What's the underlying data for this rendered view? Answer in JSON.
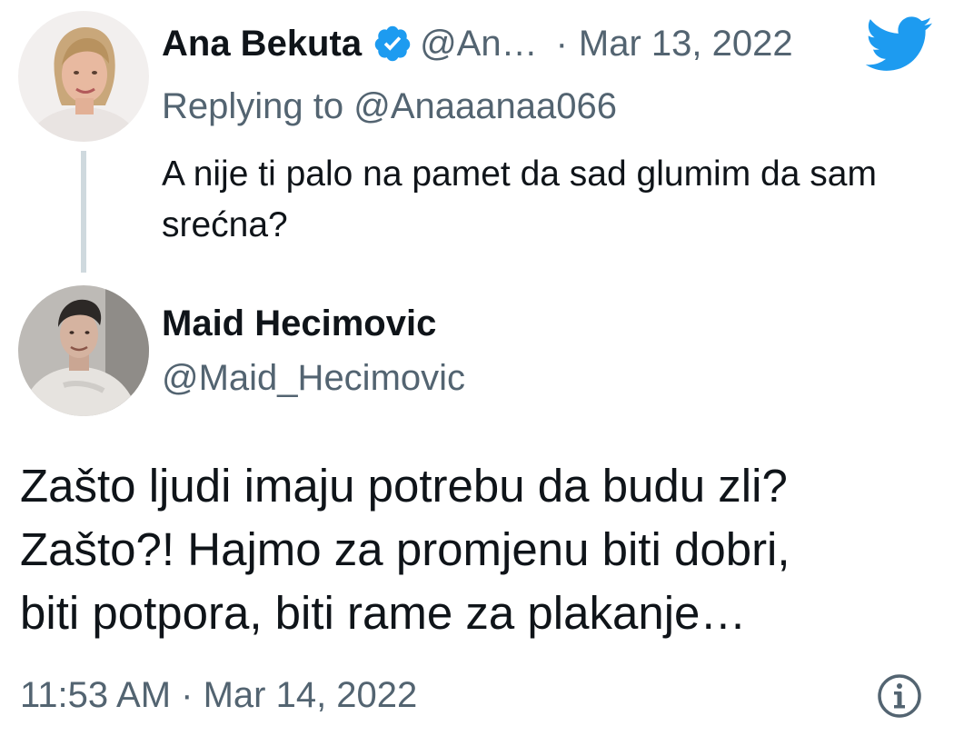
{
  "parent_tweet": {
    "author_name": "Ana Bekuta",
    "author_handle": "@An…",
    "separator": "·",
    "date": "Mar 13, 2022",
    "replying_prefix": "Replying to",
    "replying_handle": "@Anaaanaa066",
    "text": "A nije ti palo na pamet da sad glumim da sam srećna?",
    "verified_icon": "verified-badge-icon",
    "brand_icon": "twitter-bird-icon"
  },
  "main_tweet": {
    "author_name": "Maid Hecimovic",
    "author_handle": "@Maid_Hecimovic",
    "text_lines": [
      "Zašto ljudi imaju potrebu da budu zli?",
      "Zašto?! Hajmo za promjenu biti dobri,",
      "biti potpora, biti rame za plakanje…"
    ],
    "timestamp": "11:53 AM · Mar 14, 2022",
    "info_icon": "info-circle-icon"
  },
  "colors": {
    "text_primary": "#0f1419",
    "text_secondary": "#536471",
    "twitter_blue": "#1d9bf0",
    "thread_line": "#cfd9de"
  }
}
